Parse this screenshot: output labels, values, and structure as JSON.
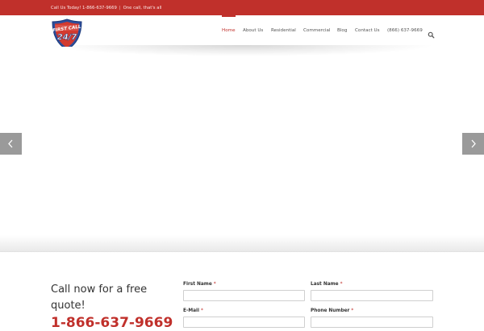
{
  "topbar": {
    "call_text": "Call Us Today! 1-866-637-9669",
    "separator": "|",
    "tagline": "One call, that's all",
    "bg_color": "#c0302b"
  },
  "logo": {
    "line1": "FIRST CALL",
    "line2": "24/7",
    "icon": "shield-logo"
  },
  "nav": {
    "items": [
      {
        "label": "Home",
        "active": true
      },
      {
        "label": "About Us"
      },
      {
        "label": "Residential"
      },
      {
        "label": "Commercial"
      },
      {
        "label": "Blog"
      },
      {
        "label": "Contact Us"
      },
      {
        "label": "(866) 637-9669"
      }
    ],
    "search_icon": "search-icon",
    "accent_color": "#c0302b"
  },
  "slider": {
    "prev_icon": "chevron-left-icon",
    "next_icon": "chevron-right-icon"
  },
  "quote": {
    "title": "Call now for a free quote!",
    "phone": "1-866-637-9669"
  },
  "form": {
    "first_name_label": "First Name",
    "last_name_label": "Last Name",
    "email_label": "E-Mail",
    "phone_label": "Phone Number",
    "required_mark": "*",
    "first_name_value": "",
    "last_name_value": "",
    "email_value": "",
    "phone_value": ""
  }
}
